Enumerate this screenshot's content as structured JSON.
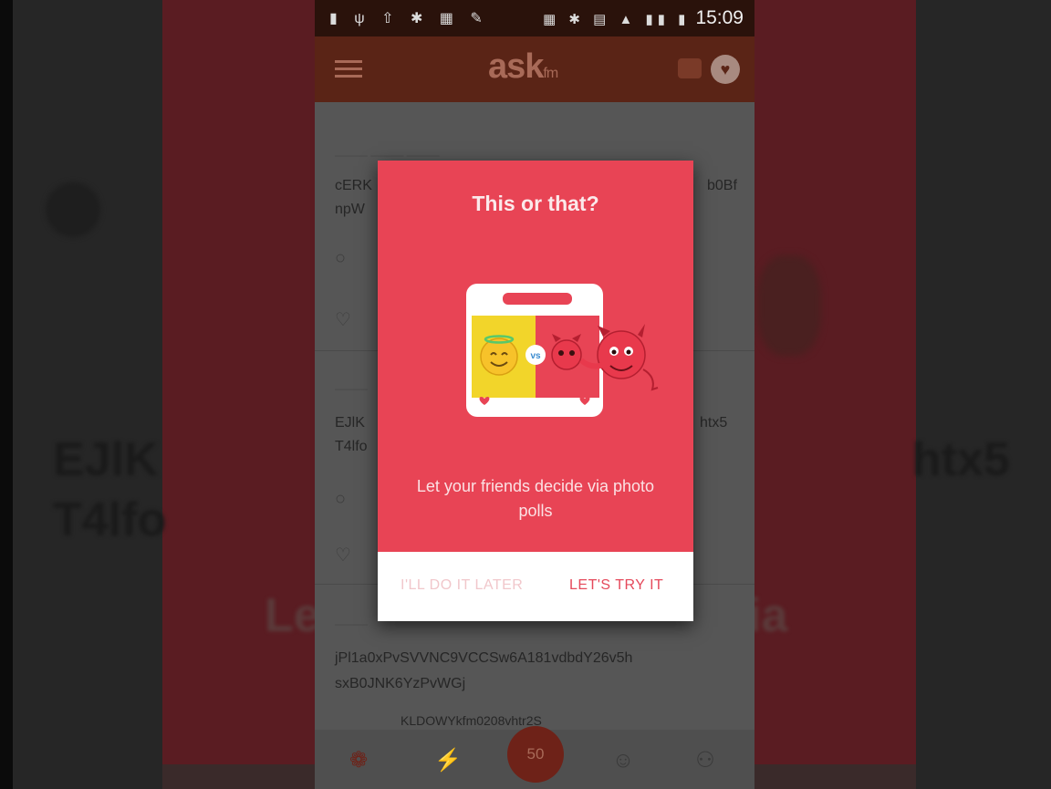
{
  "status_bar": {
    "time": "15:09"
  },
  "app_bar": {
    "logo_main": "ask",
    "logo_suffix": "fm"
  },
  "feed": {
    "rows": [
      "cERK",
      "npW",
      "EJlK",
      "T4lfo",
      "jPl1a0xPvSVVNC9VCCSw6A181vdbdY26v5h",
      "sxB0JNK6YzPvWGj",
      "KLDOWYkfm0208vhtr2S"
    ],
    "right_rows": [
      "b0Bf",
      "htx5"
    ]
  },
  "modal": {
    "title": "This or that?",
    "body": "Let your friends decide via photo polls",
    "dismiss_label": "I'LL DO IT LATER",
    "confirm_label": "LET'S TRY IT",
    "illustration_vs": "vs"
  },
  "bottom_nav": {
    "fab_label": "50"
  },
  "background": {
    "blur_text_1": "EJlK",
    "blur_text_2": "T4lfo",
    "blur_text_3": "htx5",
    "blur_text_4": "Le",
    "blur_text_5": "ia"
  },
  "colors": {
    "modal_bg": "#e84455",
    "modal_button_bg": "#ffffff",
    "confirm_text": "#e5495b",
    "app_bar": "#5a2416"
  }
}
